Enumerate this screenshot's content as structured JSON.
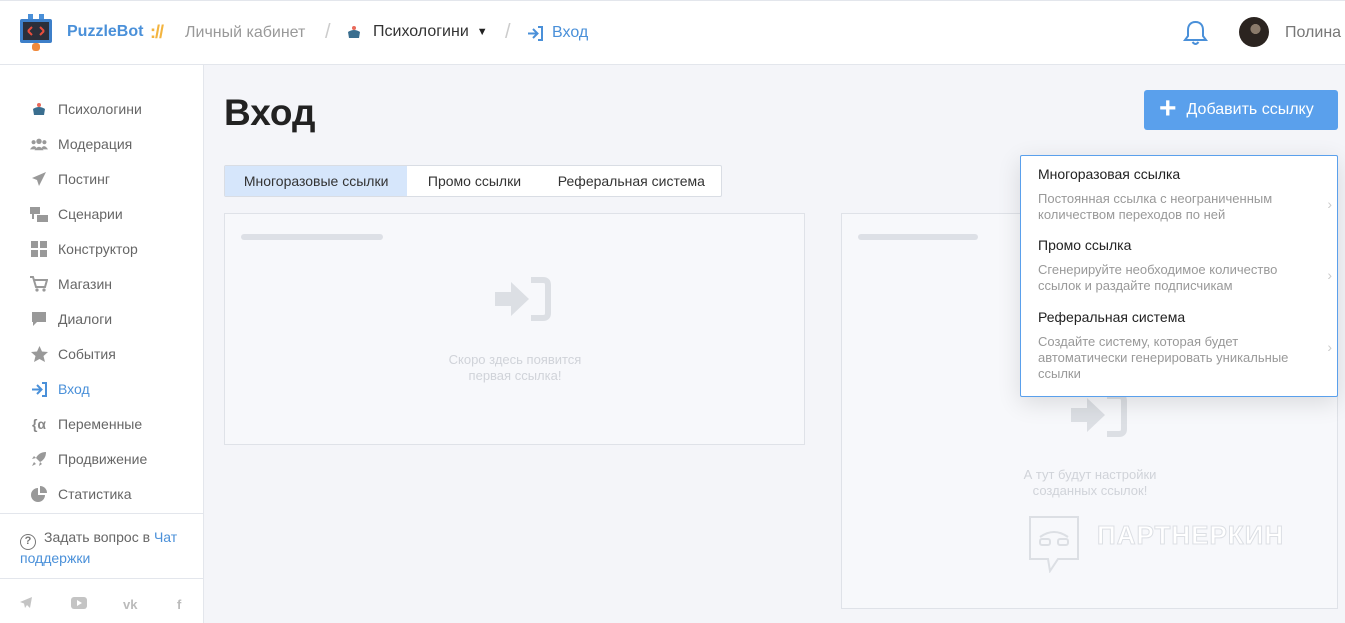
{
  "header": {
    "brand": "PuzzleBot",
    "brand_sep": "://",
    "cabinet": "Личный кабинет",
    "separator": "/",
    "project": "Психологини",
    "current_page": "Вход",
    "username": "Полина",
    "icons": {
      "bell": "bell-icon",
      "project": "cake-icon",
      "caret": "caret-down-icon",
      "login": "sign-in-icon"
    }
  },
  "sidebar": {
    "items": [
      {
        "label": "Психологини",
        "icon": "cake-icon"
      },
      {
        "label": "Модерация",
        "icon": "users-icon"
      },
      {
        "label": "Постинг",
        "icon": "paper-plane-icon"
      },
      {
        "label": "Сценарии",
        "icon": "scenario-icon"
      },
      {
        "label": "Конструктор",
        "icon": "grid-icon"
      },
      {
        "label": "Магазин",
        "icon": "cart-icon"
      },
      {
        "label": "Диалоги",
        "icon": "chat-icon"
      },
      {
        "label": "События",
        "icon": "star-icon"
      },
      {
        "label": "Вход",
        "icon": "sign-in-icon",
        "active": true
      },
      {
        "label": "Переменные",
        "icon": "variable-icon"
      },
      {
        "label": "Продвижение",
        "icon": "rocket-icon"
      },
      {
        "label": "Статистика",
        "icon": "pie-chart-icon"
      }
    ],
    "support_text": "Задать вопрос в",
    "support_link": "Чат поддержки",
    "socials": [
      "telegram-icon",
      "youtube-icon",
      "vk-icon",
      "facebook-icon"
    ]
  },
  "main": {
    "title": "Вход",
    "add_button": "Добавить ссылку",
    "tabs": [
      "Многоразовые ссылки",
      "Промо ссылки",
      "Реферальная система"
    ],
    "left_empty_text_1": "Скоро здесь появится",
    "left_empty_text_2": "первая ссылка!",
    "right_empty_text_1": "А тут будут настройки",
    "right_empty_text_2": "созданных ссылок!",
    "watermark": "ПАРТНЕРКИН"
  },
  "dropdown": {
    "items": [
      {
        "title": "Многоразовая ссылка",
        "desc": "Постоянная ссылка с неограниченным количеством переходов по ней"
      },
      {
        "title": "Промо ссылка",
        "desc": "Сгенерируйте необходимое количество ссылок и раздайте подписчикам"
      },
      {
        "title": "Реферальная система",
        "desc": "Создайте систему, которая будет автоматически генерировать уникальные ссылки"
      }
    ]
  },
  "colors": {
    "accent": "#4a90d9",
    "button": "#5aa0ec",
    "active_tab": "#d6e6fb",
    "brand_slashes": "#f3b43f"
  }
}
